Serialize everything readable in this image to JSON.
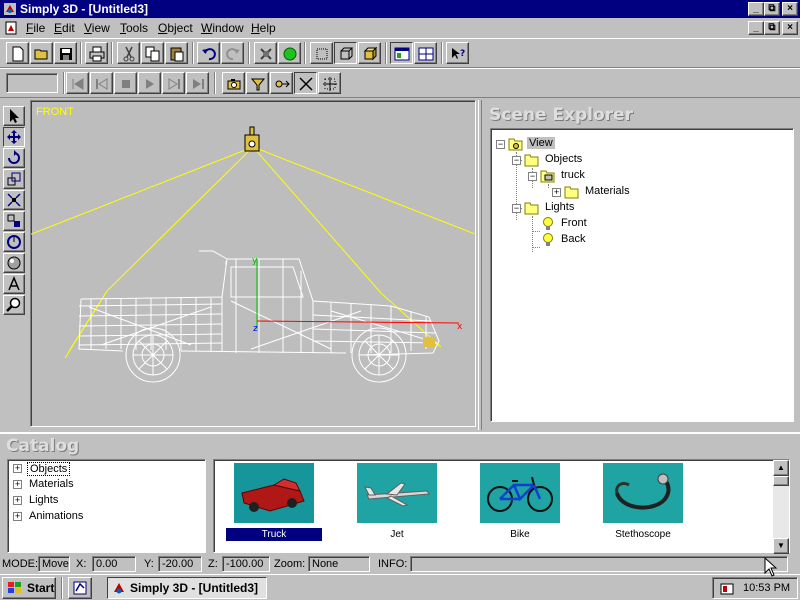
{
  "window": {
    "title": "Simply 3D - [Untitled3]"
  },
  "menu": [
    "File",
    "Edit",
    "View",
    "Tools",
    "Object",
    "Window",
    "Help"
  ],
  "toolbar1": [
    {
      "name": "new-icon"
    },
    {
      "name": "open-folder-icon"
    },
    {
      "name": "save-icon"
    },
    {
      "name": "print-icon"
    },
    {
      "name": "cut-icon"
    },
    {
      "name": "copy-icon"
    },
    {
      "name": "paste-icon"
    },
    {
      "name": "undo-icon"
    },
    {
      "name": "redo-icon"
    },
    {
      "name": "render-stop-icon"
    },
    {
      "name": "render-go-icon"
    },
    {
      "name": "wireframe-icon"
    },
    {
      "name": "box-outline-icon"
    },
    {
      "name": "solid-box-icon"
    },
    {
      "name": "layout-single-icon"
    },
    {
      "name": "layout-split-icon"
    },
    {
      "name": "help-pointer-icon"
    }
  ],
  "toolbar2": [
    {
      "name": "first-frame-icon"
    },
    {
      "name": "prev-frame-icon"
    },
    {
      "name": "stop-icon"
    },
    {
      "name": "play-icon"
    },
    {
      "name": "next-frame-icon"
    },
    {
      "name": "last-frame-icon"
    },
    {
      "name": "camera-icon"
    },
    {
      "name": "spotlight-icon"
    },
    {
      "name": "target-icon"
    },
    {
      "name": "axis-icon"
    },
    {
      "name": "grid-move-icon"
    }
  ],
  "palette": [
    {
      "name": "select-arrow-icon"
    },
    {
      "name": "move-icon"
    },
    {
      "name": "rotate-icon"
    },
    {
      "name": "scale-icon"
    },
    {
      "name": "squash-icon"
    },
    {
      "name": "taper-icon"
    },
    {
      "name": "orbit-icon"
    },
    {
      "name": "sphere-icon"
    },
    {
      "name": "text-icon"
    },
    {
      "name": "zoom-icon"
    }
  ],
  "viewport": {
    "label": "FRONT"
  },
  "scene": {
    "heading": "Scene Explorer",
    "tree": {
      "view": "View",
      "objects": "Objects",
      "truck": "truck",
      "materials": "Materials",
      "lights": "Lights",
      "front": "Front",
      "back": "Back"
    }
  },
  "catalog": {
    "heading": "Catalog",
    "categories": [
      "Objects",
      "Materials",
      "Lights",
      "Animations"
    ],
    "items": [
      {
        "label": "Truck",
        "selected": true
      },
      {
        "label": "Jet",
        "selected": false
      },
      {
        "label": "Bike",
        "selected": false
      },
      {
        "label": "Stethoscope",
        "selected": false
      }
    ]
  },
  "status": {
    "mode_label": "MODE:",
    "mode": "Move",
    "x_label": "X:",
    "x": "0.00",
    "y_label": "Y:",
    "y": "-20.00",
    "z_label": "Z:",
    "z": "-100.00",
    "zoom_label": "Zoom:",
    "zoom": "None",
    "info_label": "INFO:",
    "info": ""
  },
  "taskbar": {
    "start": "Start",
    "app": "Simply 3D - [Untitled3]",
    "clock": "10:53 PM"
  },
  "colors": {
    "titlebar": "#000080",
    "viewport_bg": "#bdbdbd",
    "wire": "#ffffff",
    "light_lines": "#ffff00",
    "axis_x": "#ff0000",
    "axis_y": "#00c000",
    "thumb_bg": "#1fa3a3"
  }
}
